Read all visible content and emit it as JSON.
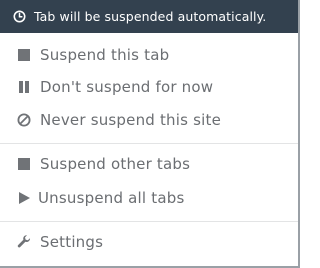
{
  "header": {
    "text": "Tab will be suspended automatically.",
    "icon": "clock-icon",
    "background": "#33414f"
  },
  "menu": {
    "suspend_tab": {
      "label": "Suspend this tab",
      "icon": "stop-square-icon"
    },
    "dont_suspend": {
      "label": "Don't suspend for now",
      "icon": "pause-icon"
    },
    "never_suspend": {
      "label": "Never suspend this site",
      "icon": "block-icon"
    },
    "suspend_others": {
      "label": "Suspend other tabs",
      "icon": "stop-square-icon"
    },
    "unsuspend_all": {
      "label": "Unsuspend all tabs",
      "icon": "play-icon"
    },
    "settings": {
      "label": "Settings",
      "icon": "wrench-icon"
    }
  },
  "colors": {
    "text": "#6b6e72",
    "icon": "#707377",
    "divider": "#e3e4e5"
  }
}
